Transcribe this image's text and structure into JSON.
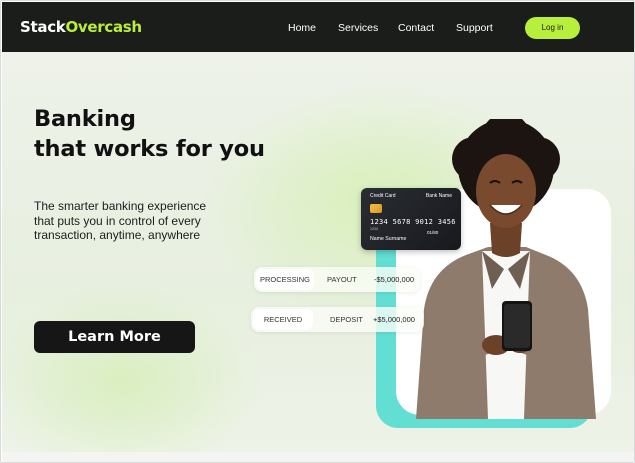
{
  "brand": {
    "name_part1": "Stack",
    "name_part2": "Overcash",
    "accent_color": "#b8ef3c"
  },
  "nav": {
    "links": [
      "Home",
      "Services",
      "Contact",
      "Support"
    ],
    "login_label": "Log in"
  },
  "hero": {
    "headline_line1": "Banking",
    "headline_line2": "that works for you",
    "subtext_line1": "The smarter banking experience",
    "subtext_line2": "that puts you in control of every",
    "subtext_line3": "transaction, anytime, anywhere",
    "cta_label": "Learn More"
  },
  "card": {
    "label": "Credit Card",
    "bank": "Bank Name",
    "number": "1234  5678  9012  3456",
    "small_number": "1234",
    "expiry": "01/80",
    "holder": "Name Surname"
  },
  "transactions": [
    {
      "status": "PROCESSING",
      "type": "PAYOUT",
      "amount": "-$5,000,000"
    },
    {
      "status": "RECEIVED",
      "type": "DEPOSIT",
      "amount": "+$5,000,000"
    }
  ],
  "colors": {
    "nav_bg": "#1b1d1a",
    "teal": "#63ded2",
    "cta_bg": "#161616"
  }
}
